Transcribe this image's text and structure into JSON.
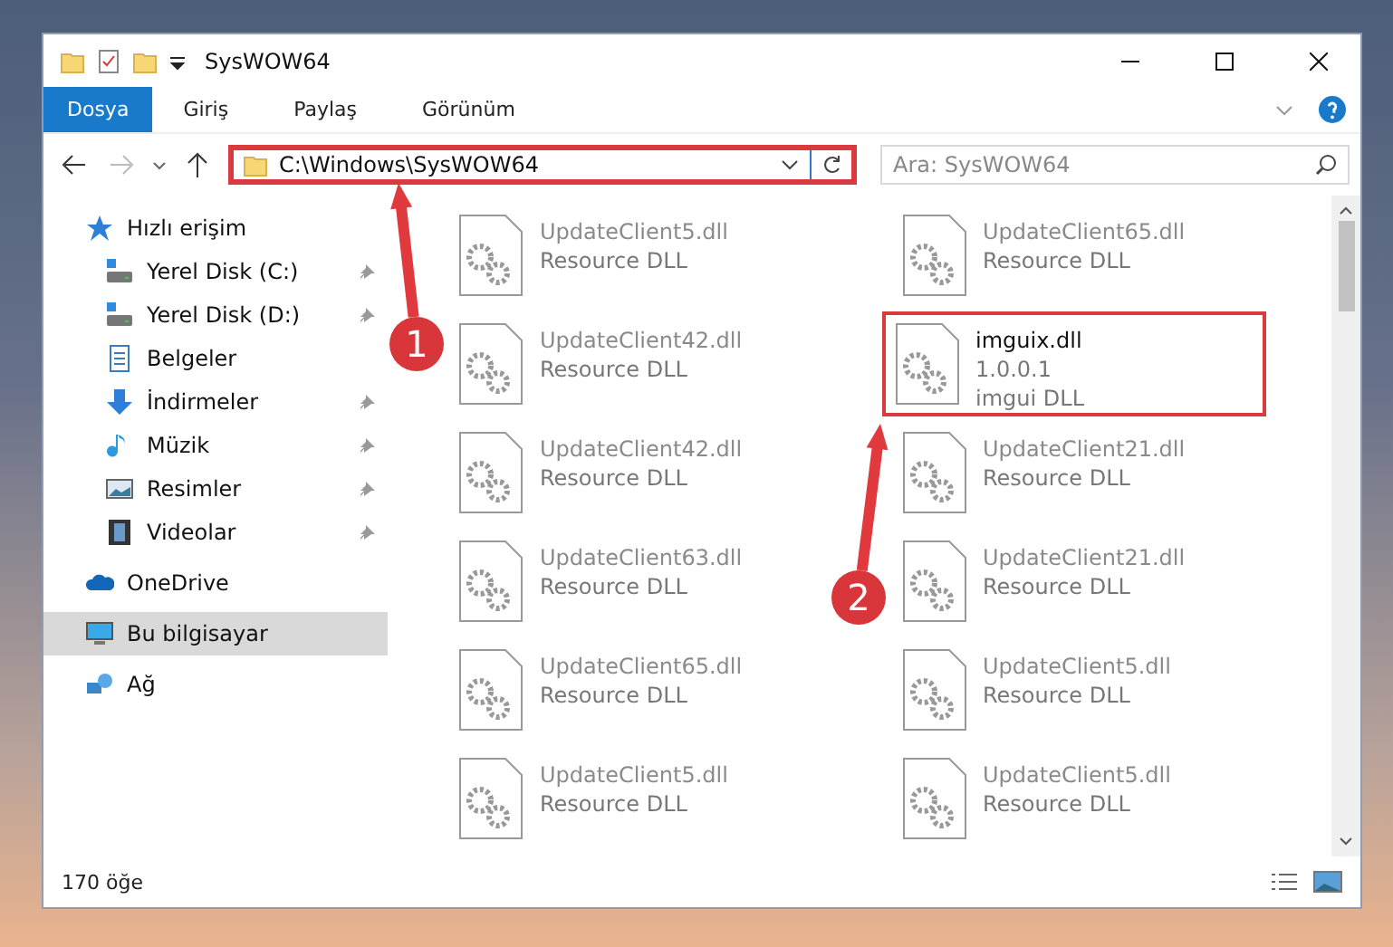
{
  "window": {
    "title": "SysWOW64"
  },
  "ribbon": {
    "tabs": [
      {
        "label": "Dosya",
        "selected": true
      },
      {
        "label": "Giriş",
        "selected": false
      },
      {
        "label": "Paylaş",
        "selected": false
      },
      {
        "label": "Görünüm",
        "selected": false
      }
    ]
  },
  "address_bar": {
    "path": "C:\\Windows\\SysWOW64",
    "highlighted": true
  },
  "search": {
    "placeholder": "Ara: SysWOW64"
  },
  "sidebar": {
    "items": [
      {
        "label": "Hızlı erişim",
        "kind": "star",
        "selected": false,
        "pinned": false,
        "children": [
          {
            "label": "Yerel Disk (C:)",
            "kind": "drive",
            "selected": false,
            "pinned": true
          },
          {
            "label": "Yerel Disk (D:)",
            "kind": "drive",
            "selected": false,
            "pinned": true
          },
          {
            "label": "Belgeler",
            "kind": "document",
            "selected": false,
            "pinned": false
          },
          {
            "label": "İndirmeler",
            "kind": "download",
            "selected": false,
            "pinned": true
          },
          {
            "label": "Müzik",
            "kind": "music",
            "selected": false,
            "pinned": true
          },
          {
            "label": "Resimler",
            "kind": "picture",
            "selected": false,
            "pinned": true
          },
          {
            "label": "Videolar",
            "kind": "video",
            "selected": false,
            "pinned": true
          }
        ]
      },
      {
        "label": "OneDrive",
        "kind": "cloud",
        "selected": false,
        "pinned": false
      },
      {
        "label": "Bu bilgisayar",
        "kind": "computer",
        "selected": true,
        "pinned": false
      },
      {
        "label": "Ağ",
        "kind": "network",
        "selected": false,
        "pinned": false
      }
    ]
  },
  "files": [
    {
      "name": "UpdateClient5.dll",
      "description": "Resource DLL",
      "blurred": true,
      "highlighted": false
    },
    {
      "name": "UpdateClient65.dll",
      "description": "Resource DLL",
      "blurred": true,
      "highlighted": false
    },
    {
      "name": "UpdateClient42.dll",
      "description": "Resource DLL",
      "blurred": true,
      "highlighted": false
    },
    {
      "name": "imguix.dll",
      "version": "1.0.0.1",
      "description": "imgui DLL",
      "blurred": false,
      "highlighted": true
    },
    {
      "name": "UpdateClient42.dll",
      "description": "Resource DLL",
      "blurred": true,
      "highlighted": false
    },
    {
      "name": "UpdateClient21.dll",
      "description": "Resource DLL",
      "blurred": true,
      "highlighted": false
    },
    {
      "name": "UpdateClient63.dll",
      "description": "Resource DLL",
      "blurred": true,
      "highlighted": false
    },
    {
      "name": "UpdateClient21.dll",
      "description": "Resource DLL",
      "blurred": true,
      "highlighted": false
    },
    {
      "name": "UpdateClient65.dll",
      "description": "Resource DLL",
      "blurred": true,
      "highlighted": false
    },
    {
      "name": "UpdateClient5.dll",
      "description": "Resource DLL",
      "blurred": true,
      "highlighted": false
    },
    {
      "name": "UpdateClient5.dll",
      "description": "Resource DLL",
      "blurred": true,
      "highlighted": false
    },
    {
      "name": "UpdateClient5.dll",
      "description": "Resource DLL",
      "blurred": true,
      "highlighted": false
    }
  ],
  "status_bar": {
    "count": "170 öğe"
  },
  "annotations": [
    {
      "number": "1"
    },
    {
      "number": "2"
    }
  ]
}
